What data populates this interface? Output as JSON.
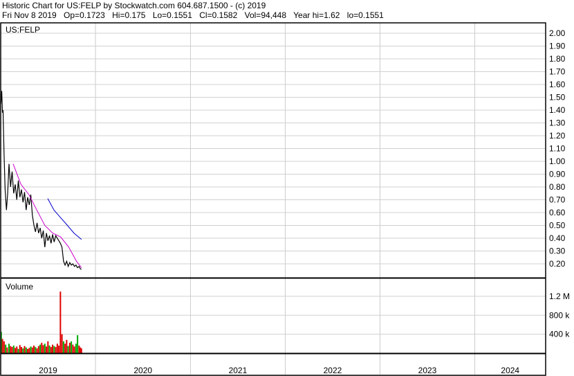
{
  "header": {
    "title": "Historic Chart for US:FELP by Stockwatch.com 604.687.1500 - (c) 2019",
    "date": "Fri Nov  8 2019",
    "open": "Op=0.1723",
    "high": "Hi=0.175",
    "low": "Lo=0.1551",
    "close": "Cl=0.1582",
    "volume": "Vol=94,448",
    "year_high": "Year hi=1.62",
    "year_low": "lo=0.1551"
  },
  "chart_data": {
    "type": "line",
    "symbol_label": "US:FELP",
    "volume_label": "Volume",
    "x_axis": {
      "years": [
        "2019",
        "2020",
        "2021",
        "2022",
        "2023",
        "2024"
      ],
      "range": [
        "2019-01-01",
        "2024-09-30"
      ]
    },
    "price_axis": {
      "ticks": [
        "2.00",
        "1.90",
        "1.80",
        "1.70",
        "1.60",
        "1.50",
        "1.40",
        "1.30",
        "1.20",
        "1.10",
        "1.00",
        "0.90",
        "0.80",
        "0.70",
        "0.60",
        "0.50",
        "0.40",
        "0.30",
        "0.20"
      ],
      "range": [
        0.12,
        2.05
      ]
    },
    "volume_axis": {
      "ticks": [
        "1.2 M",
        "800 k",
        "400 k"
      ],
      "tick_values": [
        1200000,
        800000,
        400000
      ],
      "range": [
        0,
        1550000
      ]
    },
    "series": [
      {
        "kind": "price",
        "color": "#000000",
        "x": [
          "2019-01-02",
          "2019-01-05",
          "2019-01-08",
          "2019-01-10",
          "2019-01-14",
          "2019-01-18",
          "2019-01-23",
          "2019-01-28",
          "2019-02-02",
          "2019-02-08",
          "2019-02-14",
          "2019-02-20",
          "2019-02-26",
          "2019-03-04",
          "2019-03-10",
          "2019-03-16",
          "2019-03-22",
          "2019-03-28",
          "2019-04-03",
          "2019-04-09",
          "2019-04-15",
          "2019-04-21",
          "2019-04-27",
          "2019-05-03",
          "2019-05-09",
          "2019-05-15",
          "2019-05-21",
          "2019-05-27",
          "2019-06-02",
          "2019-06-08",
          "2019-06-14",
          "2019-06-20",
          "2019-06-26",
          "2019-07-02",
          "2019-07-08",
          "2019-07-14",
          "2019-07-20",
          "2019-07-26",
          "2019-08-01",
          "2019-08-07",
          "2019-08-13",
          "2019-08-19",
          "2019-08-25",
          "2019-08-31",
          "2019-09-06",
          "2019-09-12",
          "2019-09-18",
          "2019-09-24",
          "2019-09-30",
          "2019-10-06",
          "2019-10-12",
          "2019-10-18",
          "2019-10-24",
          "2019-10-30",
          "2019-11-04",
          "2019-11-08"
        ],
        "values": [
          1.45,
          1.55,
          1.38,
          1.4,
          1.05,
          0.78,
          0.62,
          0.75,
          0.98,
          0.8,
          0.92,
          0.75,
          0.82,
          0.7,
          0.85,
          0.72,
          0.78,
          0.68,
          0.76,
          0.62,
          0.72,
          0.66,
          0.74,
          0.58,
          0.5,
          0.45,
          0.52,
          0.44,
          0.48,
          0.4,
          0.46,
          0.33,
          0.44,
          0.38,
          0.42,
          0.36,
          0.43,
          0.37,
          0.42,
          0.4,
          0.38,
          0.36,
          0.33,
          0.22,
          0.19,
          0.22,
          0.18,
          0.21,
          0.19,
          0.2,
          0.18,
          0.19,
          0.17,
          0.18,
          0.16,
          0.158
        ]
      },
      {
        "kind": "moving-average-short",
        "color": "#cc00cc",
        "x": [
          "2019-02-18",
          "2019-03-20",
          "2019-04-20",
          "2019-05-20",
          "2019-06-20",
          "2019-07-20",
          "2019-08-20",
          "2019-09-20",
          "2019-10-20",
          "2019-11-08"
        ],
        "values": [
          0.98,
          0.82,
          0.74,
          0.62,
          0.5,
          0.44,
          0.41,
          0.33,
          0.22,
          0.17
        ]
      },
      {
        "kind": "moving-average-long",
        "color": "#0000cc",
        "x": [
          "2019-07-01",
          "2019-07-25",
          "2019-08-20",
          "2019-09-15",
          "2019-10-10",
          "2019-11-08"
        ],
        "values": [
          0.71,
          0.62,
          0.56,
          0.5,
          0.44,
          0.39
        ]
      }
    ],
    "volume_bars": {
      "up_color": "#00aa00",
      "down_color": "#dd0000",
      "x": [
        "2019-01-03",
        "2019-01-08",
        "2019-01-14",
        "2019-01-20",
        "2019-01-26",
        "2019-02-02",
        "2019-02-08",
        "2019-02-14",
        "2019-02-20",
        "2019-02-26",
        "2019-03-04",
        "2019-03-10",
        "2019-03-16",
        "2019-03-22",
        "2019-03-28",
        "2019-04-03",
        "2019-04-09",
        "2019-04-15",
        "2019-04-21",
        "2019-04-27",
        "2019-05-03",
        "2019-05-09",
        "2019-05-15",
        "2019-05-21",
        "2019-05-27",
        "2019-06-02",
        "2019-06-08",
        "2019-06-14",
        "2019-06-20",
        "2019-06-26",
        "2019-07-02",
        "2019-07-08",
        "2019-07-14",
        "2019-07-20",
        "2019-07-26",
        "2019-08-01",
        "2019-08-07",
        "2019-08-13",
        "2019-08-19",
        "2019-08-25",
        "2019-08-31",
        "2019-09-06",
        "2019-09-12",
        "2019-09-18",
        "2019-09-24",
        "2019-09-30",
        "2019-10-06",
        "2019-10-12",
        "2019-10-18",
        "2019-10-24",
        "2019-10-30",
        "2019-11-04",
        "2019-11-08"
      ],
      "values": [
        450000,
        300000,
        250000,
        180000,
        120000,
        200000,
        150000,
        130000,
        160000,
        110000,
        140000,
        90000,
        170000,
        130000,
        100000,
        150000,
        120000,
        90000,
        110000,
        140000,
        120000,
        160000,
        130000,
        100000,
        150000,
        180000,
        220000,
        170000,
        200000,
        140000,
        250000,
        160000,
        130000,
        180000,
        150000,
        130000,
        200000,
        160000,
        1300000,
        400000,
        250000,
        200000,
        280000,
        150000,
        220000,
        250000,
        180000,
        140000,
        200000,
        380000,
        160000,
        120000,
        100000
      ],
      "up": [
        true,
        false,
        false,
        true,
        false,
        true,
        false,
        false,
        true,
        false,
        false,
        true,
        false,
        false,
        true,
        false,
        true,
        false,
        false,
        true,
        false,
        false,
        true,
        false,
        false,
        true,
        false,
        false,
        true,
        false,
        false,
        true,
        false,
        false,
        true,
        false,
        false,
        false,
        false,
        false,
        true,
        false,
        false,
        true,
        false,
        true,
        false,
        false,
        true,
        true,
        false,
        false,
        false
      ]
    }
  }
}
